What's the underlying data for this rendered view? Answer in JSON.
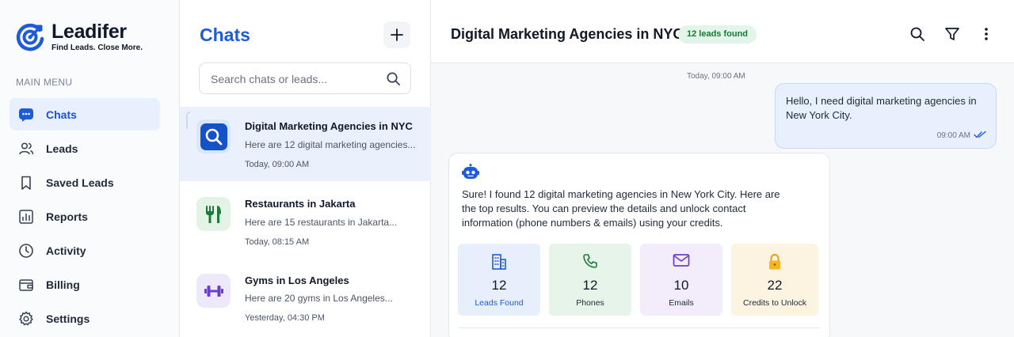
{
  "brand": {
    "name": "Leadifer",
    "tagline": "Find Leads. Close More."
  },
  "sidebar": {
    "menu_title": "MAIN MENU",
    "items": [
      {
        "label": "Chats",
        "icon": "chat-bubble-icon",
        "active": true
      },
      {
        "label": "Leads",
        "icon": "users-icon"
      },
      {
        "label": "Saved Leads",
        "icon": "bookmark-icon"
      },
      {
        "label": "Reports",
        "icon": "bar-chart-icon"
      },
      {
        "label": "Activity",
        "icon": "clock-icon"
      },
      {
        "label": "Billing",
        "icon": "wallet-icon"
      },
      {
        "label": "Settings",
        "icon": "gear-icon"
      }
    ]
  },
  "chatlist": {
    "title": "Chats",
    "search_placeholder": "Search chats or leads...",
    "items": [
      {
        "title": "Digital Marketing Agencies in NYC",
        "preview": "Here are 12 digital marketing agencies...",
        "time": "Today, 09:00 AM",
        "icon": "search-icon",
        "active": true
      },
      {
        "title": "Restaurants in Jakarta",
        "preview": "Here are 15 restaurants in Jakarta...",
        "time": "Today, 08:15 AM",
        "icon": "fork-knife-icon"
      },
      {
        "title": "Gyms in Los Angeles",
        "preview": "Here are 20 gyms in Los Angeles...",
        "time": "Yesterday, 04:30 PM",
        "icon": "dumbbell-icon"
      }
    ]
  },
  "conversation": {
    "title": "Digital Marketing Agencies in NYC",
    "badge": "12 leads found",
    "day_separator": "Today, 09:00 AM",
    "user_message": {
      "text": "Hello, I need digital marketing agencies in New York City.",
      "time": "09:00 AM"
    },
    "bot_message": {
      "text": "Sure! I found 12 digital marketing agencies in New York City. Here are the top results. You can preview the details and unlock contact information (phone numbers & emails) using your credits.",
      "stats": [
        {
          "value": "12",
          "label": "Leads Found",
          "icon": "building-icon"
        },
        {
          "value": "12",
          "label": "Phones",
          "icon": "phone-icon"
        },
        {
          "value": "10",
          "label": "Emails",
          "icon": "mail-icon"
        },
        {
          "value": "22",
          "label": "Credits to Unlock",
          "icon": "lock-icon"
        }
      ]
    }
  },
  "colors": {
    "brand_blue": "#1e5bd8",
    "badge_green": "#157a35",
    "active_bg": "#e9f0fd"
  }
}
